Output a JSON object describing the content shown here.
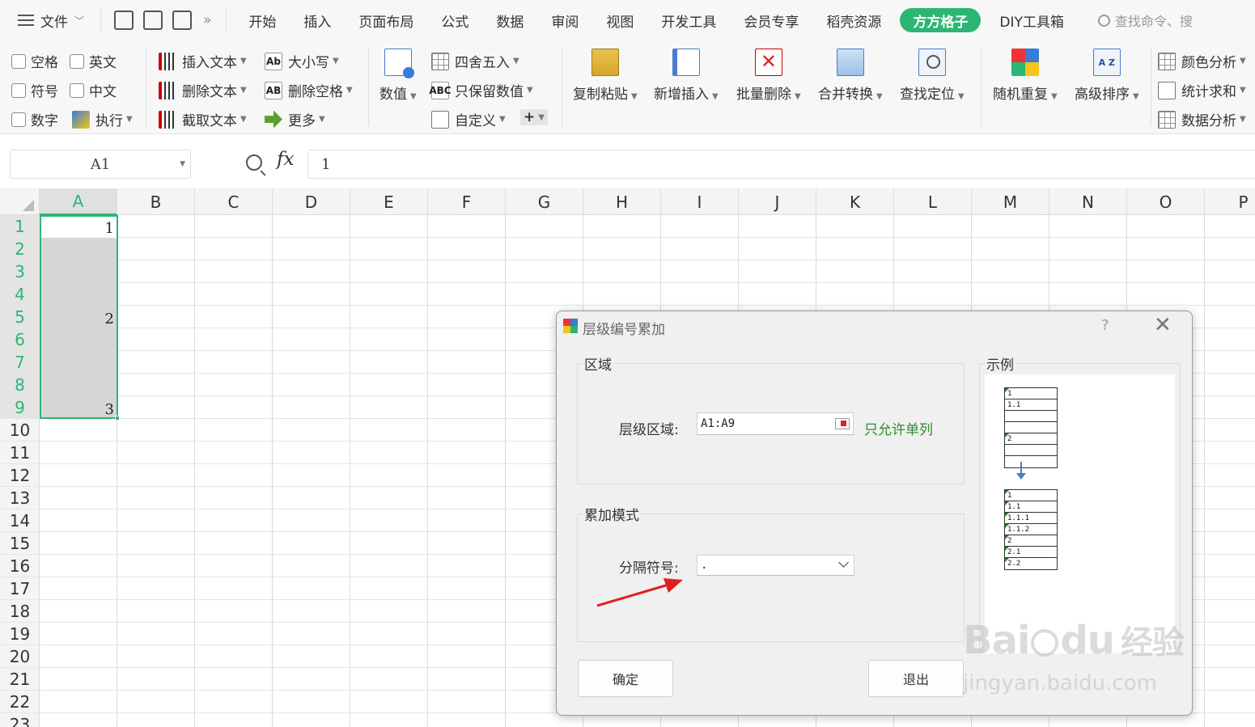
{
  "menubar": {
    "file_label": "文件",
    "tabs": [
      "开始",
      "插入",
      "页面布局",
      "公式",
      "数据",
      "审阅",
      "视图",
      "开发工具",
      "会员专享",
      "稻壳资源"
    ],
    "active_tab": "方方格子",
    "extra_tab": "DIY工具箱",
    "search_placeholder": "查找命令、搜"
  },
  "ribbon": {
    "checkboxes": {
      "space": "空格",
      "english": "英文",
      "symbol": "符号",
      "chinese": "中文",
      "digit": "数字",
      "execute": "执行"
    },
    "text_group": {
      "insert": "插入文本",
      "delete": "删除文本",
      "extract": "截取文本"
    },
    "case_group": {
      "case": "大小写",
      "remove_space": "删除空格",
      "more": "更多"
    },
    "number": "数值",
    "round_group": {
      "round": "四舍五入",
      "keep_numbers": "只保留数值",
      "custom": "自定义"
    },
    "big_buttons": {
      "copy_paste": "复制粘贴",
      "add_insert": "新增插入",
      "batch_delete": "批量删除",
      "merge_convert": "合并转换",
      "find_locate": "查找定位",
      "random_repeat": "随机重复",
      "advanced_sort": "高级排序"
    },
    "sort_icon_text": "A Z",
    "analysis_group": {
      "color_analysis": "颜色分析",
      "stat_sum": "统计求和",
      "data_analysis": "数据分析"
    }
  },
  "formula_bar": {
    "name_box": "A1",
    "fx": "fx",
    "value": "1"
  },
  "grid": {
    "columns": [
      "A",
      "B",
      "C",
      "D",
      "E",
      "F",
      "G",
      "H",
      "I",
      "J",
      "K",
      "L",
      "M",
      "N",
      "O",
      "P"
    ],
    "rows": [
      "1",
      "2",
      "3",
      "4",
      "5",
      "6",
      "7",
      "8",
      "9",
      "10",
      "11",
      "12",
      "13",
      "14",
      "15",
      "16",
      "17",
      "18",
      "19",
      "20",
      "21",
      "22",
      "23"
    ],
    "values": {
      "A1": "1",
      "A5": "2",
      "A9": "3"
    }
  },
  "dialog": {
    "title": "层级编号累加",
    "help": "?",
    "close": "✕",
    "area_legend": "区域",
    "range_label": "层级区域:",
    "range_value": "A1:A9",
    "range_hint": "只允许单列",
    "mode_legend": "累加模式",
    "separator_label": "分隔符号:",
    "separator_value": ".",
    "example_legend": "示例",
    "example_before": [
      "1",
      "1.1",
      "",
      "",
      "2",
      "",
      ""
    ],
    "example_after": [
      "1",
      "1.1",
      "1.1.1",
      "1.1.2",
      "2",
      "2.1",
      "2.2"
    ],
    "ok_label": "确定",
    "exit_label": "退出"
  },
  "watermark": {
    "brand": "Bai",
    "brand2": "du",
    "brand3": "经验",
    "url": "jingyan.baidu.com"
  },
  "colors": {
    "accent_green": "#2bb673",
    "hint_green": "#2e8b2e",
    "arrow_red": "#e02020"
  }
}
